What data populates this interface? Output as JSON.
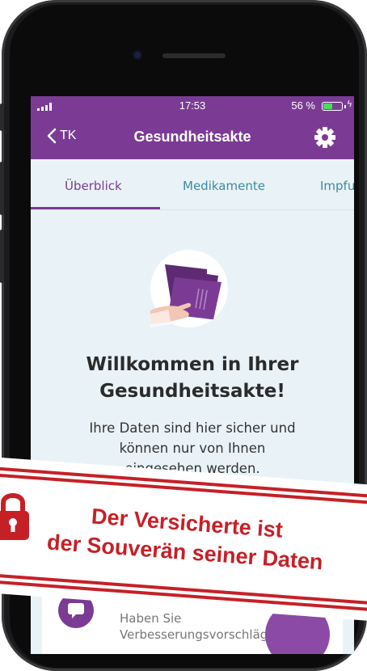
{
  "status_bar": {
    "time": "17:53",
    "battery_percent": "56 %",
    "battery_level": 0.56
  },
  "nav": {
    "back_label": "TK",
    "title": "Gesundheitsakte"
  },
  "tabs": [
    {
      "label": "Überblick",
      "active": true
    },
    {
      "label": "Medikamente",
      "active": false
    },
    {
      "label": "Impfu",
      "active": false
    }
  ],
  "welcome": {
    "title_line1": "Willkommen in Ihrer",
    "title_line2": "Gesundheitsakte!",
    "text_line1": "Ihre Daten sind hier sicher und",
    "text_line2": "können nur von Ihnen",
    "text_line3": "eingesehen werden."
  },
  "card": {
    "line1": "Haben Sie",
    "line2": "Verbesserungsvorschläge?"
  },
  "banner": {
    "line1": "Der Versicherte ist",
    "line2": "der Souverän seiner Daten"
  },
  "colors": {
    "brand_purple": "#7b3b94",
    "tab_inactive": "#3c8aa0",
    "banner_red": "#c62027",
    "background": "#e9f3f7"
  },
  "icons": [
    "back-chevron-icon",
    "gear-icon",
    "signal-icon",
    "battery-icon",
    "charging-bolt-icon",
    "folder-hand-illustration",
    "feedback-icon",
    "lock-icon"
  ]
}
